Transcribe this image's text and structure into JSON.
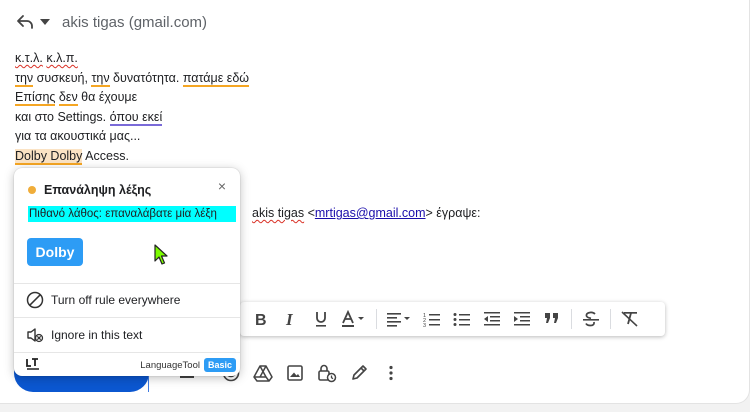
{
  "header": {
    "recipient": "akis tigas (gmail.com)"
  },
  "body": {
    "line1": {
      "w1": "κ.τ.λ.",
      "sp": " ",
      "w2": "κ.λ.π."
    },
    "line2": {
      "a": "την",
      "b": " συσκευή, ",
      "c": "την",
      "d": " δυνατότητα. ",
      "e": "πατάμε εδώ"
    },
    "line3": {
      "a": "Επίσης",
      "b": " ",
      "c": "δεν",
      "d": " θα έχουμε"
    },
    "line4": {
      "a": "και στο Settings. ",
      "b": "όπου εκεί"
    },
    "line5": "για τα ακουστικά μας...",
    "line6": {
      "a": "Dolby Dolby",
      "b": " Access."
    },
    "quote": {
      "sender": "akis tigas",
      "open": " <",
      "email": "mrtigas@gmail.com",
      "close": "> έγραψε:"
    }
  },
  "languagetool": {
    "title": "Επανάληψη λέξης",
    "close_glyph": "×",
    "message": "Πιθανό λάθος: επαναλάβατε μία λέξη",
    "suggestion": "Dolby",
    "actions": {
      "turn_off": "Turn off rule everywhere",
      "ignore": "Ignore in this text"
    },
    "brand": "LanguageTool",
    "badge": "Basic"
  },
  "colors": {
    "accent_blue": "#2d9cf5",
    "send_blue": "#0b57d0",
    "highlight_cyan": "#00ffff",
    "warning_dot": "#f0ad3a"
  },
  "icons": {
    "header": [
      "reply-icon",
      "chevron-down-icon"
    ],
    "toolbar": [
      "bold-icon",
      "italic-icon",
      "underline-icon",
      "text-color-icon",
      "align-icon",
      "numbered-list-icon",
      "bulleted-list-icon",
      "indent-less-icon",
      "indent-more-icon",
      "quote-icon",
      "strikethrough-icon",
      "clear-formatting-icon"
    ],
    "bottom": [
      "emoji-icon",
      "drive-icon",
      "image-icon",
      "lock-clock-icon",
      "signature-icon",
      "more-vert-icon"
    ]
  }
}
